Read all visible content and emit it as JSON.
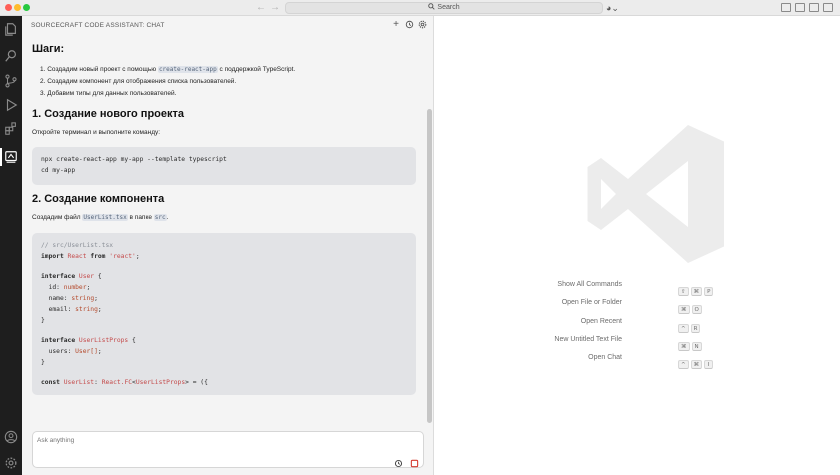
{
  "titlebar": {
    "search_label": "Search",
    "account_glyph": "◕⌄"
  },
  "chat": {
    "header_title": "SOURCECRAFT CODE ASSISTANT: CHAT",
    "header_icons": [
      "plus-icon",
      "history-icon",
      "gear-icon"
    ],
    "steps_heading": "Шаги:",
    "steps": [
      {
        "num": "1.",
        "before": "Создадим новый проект с помощью ",
        "code": "create-react-app",
        "after": " с поддержкой TypeScript."
      },
      {
        "num": "2.",
        "before": "Создадим компонент для отображения списка пользователей.",
        "code": "",
        "after": ""
      },
      {
        "num": "3.",
        "before": "Добавим типы для данных пользователей.",
        "code": "",
        "after": ""
      }
    ],
    "section1_title": "1. Создание нового проекта",
    "section1_text": "Откройте терминал и выполните команду:",
    "section1_code": [
      "npx create-react-app my-app --template typescript",
      "cd my-app"
    ],
    "section2_title": "2. Создание компонента",
    "section2_text_before": "Создадим файл ",
    "section2_file": "UserList.tsx",
    "section2_text_mid": " в папке ",
    "section2_folder": "src",
    "section2_text_after": ".",
    "code2": {
      "comment": "// src/UserList.tsx",
      "import_kw": "import",
      "import_name": "React",
      "from_kw": "from",
      "import_src": "'react'",
      "semi": ";",
      "iface_kw": "interface",
      "iface1": "User",
      "brace_open": "{",
      "brace_close": "}",
      "f1": "id:",
      "t1": "number",
      "f2": "name:",
      "t2": "string",
      "f3": "email:",
      "t3": "string",
      "iface2": "UserListProps",
      "f4": "users:",
      "t4": "User[]",
      "const_kw": "const",
      "comp": "UserList",
      "colon": ":",
      "react_fc": "React.FC",
      "generic_open": "<",
      "generic_type": "UserListProps",
      "generic_close": ">",
      "arrow": " = ({"
    },
    "input_placeholder": "Ask anything"
  },
  "editor": {
    "commands": [
      {
        "label": "Show All Commands",
        "keys": [
          "⇧",
          "⌘",
          "P"
        ]
      },
      {
        "label": "Open File or Folder",
        "keys": [
          "⌘",
          "O"
        ]
      },
      {
        "label": "Open Recent",
        "keys": [
          "^",
          "R"
        ]
      },
      {
        "label": "New Untitled Text File",
        "keys": [
          "⌘",
          "N"
        ]
      },
      {
        "label": "Open Chat",
        "keys": [
          "^",
          "⌘",
          "I"
        ]
      }
    ]
  },
  "colors": {
    "activity_bar": "#1e1e1e",
    "chat_bg": "#f4f4f4",
    "code_bg": "#e2e3e6",
    "type_red": "#c44a4a",
    "logo_gray": "#ececec"
  }
}
